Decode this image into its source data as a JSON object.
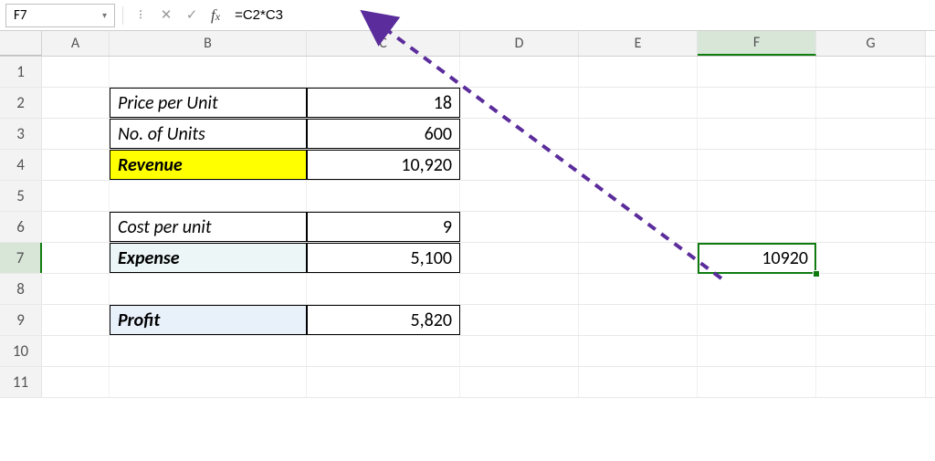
{
  "name_box": "F7",
  "formula": "=C2*C3",
  "columns": [
    "A",
    "B",
    "C",
    "D",
    "E",
    "F",
    "G"
  ],
  "rows": [
    "1",
    "2",
    "3",
    "4",
    "5",
    "6",
    "7",
    "8",
    "9",
    "10",
    "11"
  ],
  "cells": {
    "B2": "Price per Unit",
    "C2": "18",
    "B3": "No. of Units",
    "C3": "600",
    "B4": "Revenue",
    "C4": "10,920",
    "B6": "Cost per unit",
    "C6": "9",
    "B7": "Expense",
    "C7": "5,100",
    "B9": "Profit",
    "C9": "5,820",
    "F7": "10920"
  },
  "selected_cell": "F7",
  "selected_col": "F",
  "selected_row": "7",
  "chart_data": {
    "type": "table",
    "title": "",
    "rows": [
      {
        "label": "Price per Unit",
        "value": 18
      },
      {
        "label": "No. of Units",
        "value": 600
      },
      {
        "label": "Revenue",
        "value": 10920
      },
      {
        "label": "Cost per unit",
        "value": 9
      },
      {
        "label": "Expense",
        "value": 5100
      },
      {
        "label": "Profit",
        "value": 5820
      }
    ],
    "computed": {
      "cell": "F7",
      "formula": "=C2*C3",
      "value": 10920
    }
  }
}
